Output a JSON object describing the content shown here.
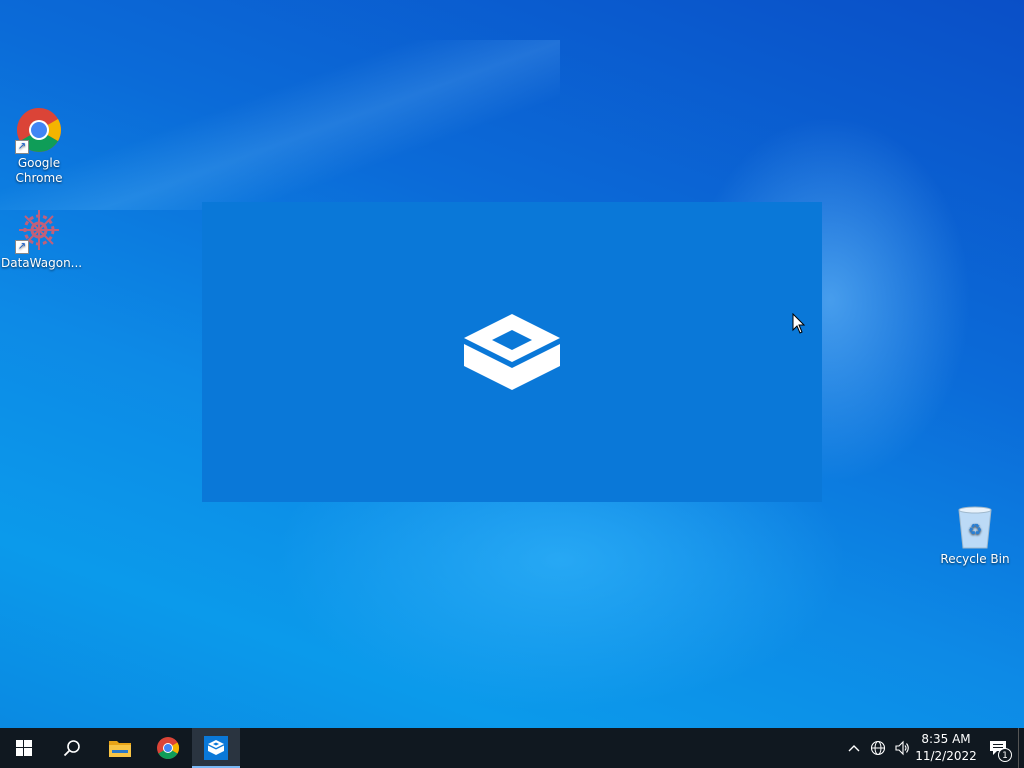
{
  "desktop": {
    "icons": [
      {
        "label": "Google Chrome",
        "icon": "chrome-icon"
      },
      {
        "label": "DataWagon...",
        "icon": "datawagon-icon"
      },
      {
        "label": "Recycle Bin",
        "icon": "recycle-bin-icon"
      }
    ]
  },
  "splash": {
    "icon": "sandbox-box-icon",
    "color": "#0a78d8"
  },
  "taskbar": {
    "items": [
      {
        "name": "Start",
        "icon": "windows-logo-icon"
      },
      {
        "name": "Search",
        "icon": "search-icon"
      },
      {
        "name": "File Explorer",
        "icon": "folder-icon"
      },
      {
        "name": "Google Chrome",
        "icon": "chrome-icon"
      },
      {
        "name": "Windows Sandbox",
        "icon": "sandbox-box-icon",
        "active": true
      }
    ],
    "tray": {
      "time": "8:35 AM",
      "date": "11/2/2022",
      "notification_count": "1"
    }
  }
}
